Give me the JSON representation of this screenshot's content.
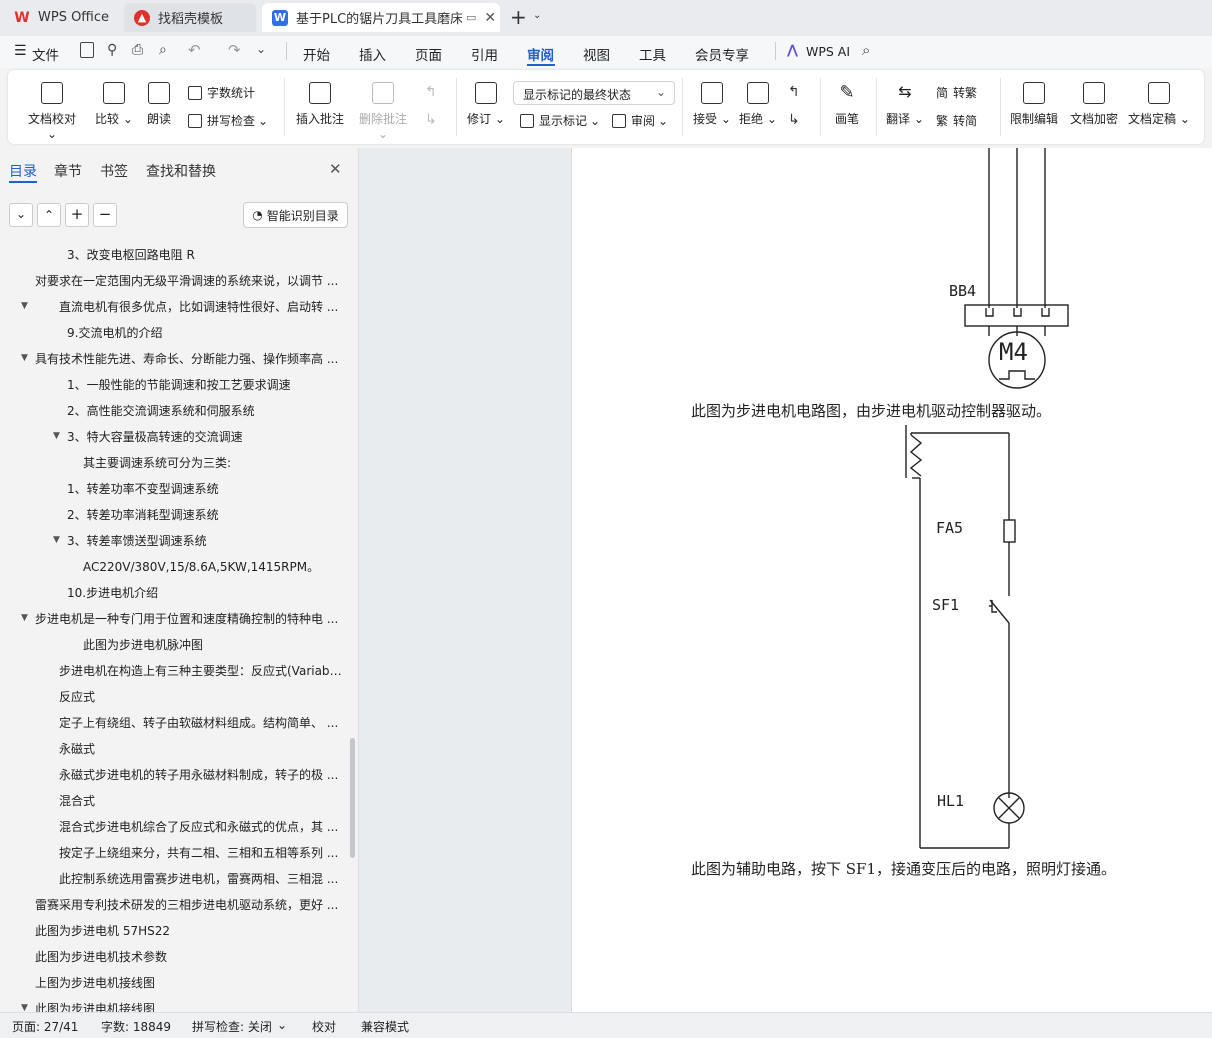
{
  "tabs": [
    {
      "label": "WPS Office",
      "icon": "wps-logo-icon"
    },
    {
      "label": "找稻壳模板",
      "icon": "docer-icon"
    },
    {
      "label": "基于PLC的锯片刀具工具磨床扌",
      "icon": "writer-doc-icon"
    }
  ],
  "menu": {
    "file": "文件",
    "items": [
      "开始",
      "插入",
      "页面",
      "引用",
      "审阅",
      "视图",
      "工具",
      "会员专享"
    ],
    "active": "审阅",
    "ai": "WPS AI"
  },
  "ribbon": {
    "doc_check": "文档校对",
    "compare": "比较",
    "read_aloud": "朗读",
    "word_count": "字数统计",
    "spell_check": "拼写检查",
    "insert_comment": "插入批注",
    "delete_comment": "删除批注",
    "revise": "修订",
    "markup_state": "显示标记的最终状态",
    "show_markup": "显示标记",
    "review": "审阅",
    "accept": "接受",
    "reject": "拒绝",
    "pen": "画笔",
    "translate": "翻译",
    "to_traditional": "转繁",
    "to_simplified": "转简",
    "fan": "繁",
    "jian": "简",
    "restrict_edit": "限制编辑",
    "encrypt": "文档加密",
    "finalize": "文档定稿"
  },
  "panel": {
    "tabs": [
      "目录",
      "章节",
      "书签",
      "查找和替换"
    ],
    "active_tab": "目录",
    "smart_toc": "智能识别目录",
    "toc": [
      "3、改变电枢回路电阻 R",
      "对要求在一定范围内无级平滑调速的系统来说，以调节 ...",
      "直流电机有很多优点，比如调速特性很好、启动转 ...",
      "9.交流电机的介绍",
      "具有技术性能先进、寿命长、分断能力强、操作频率高 ...",
      "1、一般性能的节能调速和按工艺要求调速",
      "2、高性能交流调速系统和伺服系统",
      "3、特大容量极高转速的交流调速",
      "其主要调速系统可分为三类:",
      "1、转差功率不变型调速系统",
      "2、转差功率消耗型调速系统",
      "3、转差率馈送型调速系统",
      "AC220V/380V,15/8.6A,5KW,1415RPM。",
      "10.步进电机介绍",
      "步进电机是一种专门用于位置和速度精确控制的特种电 ...",
      "此图为步进电机脉冲图",
      "步进电机在构造上有三种主要类型：反应式(Variab ...",
      "反应式",
      "定子上有绕组、转子由软磁材料组成。结构简单、 ...",
      "永磁式",
      "永磁式步进电机的转子用永磁材料制成，转子的极 ...",
      "混合式",
      "混合式步进电机综合了反应式和永磁式的优点，其 ...",
      "按定子上绕组来分，共有二相、三相和五相等系列 ...",
      "此控制系统选用雷赛步进电机，雷赛两相、三相混 ...",
      "雷赛采用专利技术研发的三相步进电机驱动系统，更好 ...",
      "此图为步进电机 57HS22",
      "此图为步进电机技术参数",
      "上图为步进电机接线图",
      "此图为步进电机接线图"
    ]
  },
  "document": {
    "labels": {
      "bb4": "BB4",
      "m4": "M4",
      "fa5": "FA5",
      "sf1": "SF1",
      "hl1": "HL1"
    },
    "caption1": "此图为步进电机电路图，由步进电机驱动控制器驱动。",
    "caption2": "此图为辅助电路，按下 SF1，接通变压后的电路，照明灯接通。"
  },
  "status": {
    "page": "页面: 27/41",
    "words": "字数: 18849",
    "spell": "拼写检查: 关闭",
    "proof": "校对",
    "compat": "兼容模式"
  },
  "colors": {
    "accent": "#1f5fd1",
    "wps_red": "#e0312d",
    "writer_blue": "#2f6fe4"
  }
}
